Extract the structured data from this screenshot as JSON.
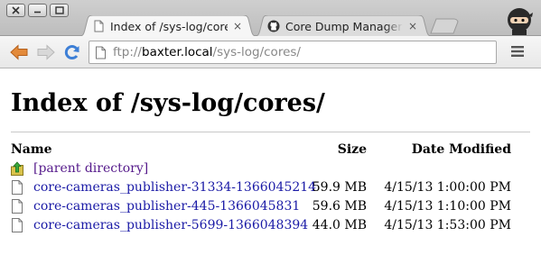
{
  "tabs": [
    {
      "title": "Index of /sys-log/cores/",
      "close": "×",
      "icon": "page-icon"
    },
    {
      "title": "Core Dump Manager (P",
      "close": "×",
      "icon": "github-icon"
    }
  ],
  "address": {
    "scheme": "ftp://",
    "host": "baxter.local",
    "path": "/sys-log/cores/"
  },
  "page": {
    "heading": "Index of /sys-log/cores/",
    "columns": {
      "name": "Name",
      "size": "Size",
      "date": "Date Modified"
    },
    "parent": {
      "label": "[parent directory]",
      "icon": "up-folder-icon"
    },
    "files": [
      {
        "name": "core-cameras_publisher-31334-1366045214",
        "size": "59.9 MB",
        "date": "4/15/13 1:00:00 PM"
      },
      {
        "name": "core-cameras_publisher-445-1366045831",
        "size": "59.6 MB",
        "date": "4/15/13 1:10:00 PM"
      },
      {
        "name": "core-cameras_publisher-5699-1366048394",
        "size": "44.0 MB",
        "date": "4/15/13 1:53:00 PM"
      }
    ]
  },
  "colors": {
    "link": "#1a1aa6",
    "visited_link": "#551a8b",
    "back_arrow": "#e07b2a",
    "reload": "#3d7fd6"
  }
}
